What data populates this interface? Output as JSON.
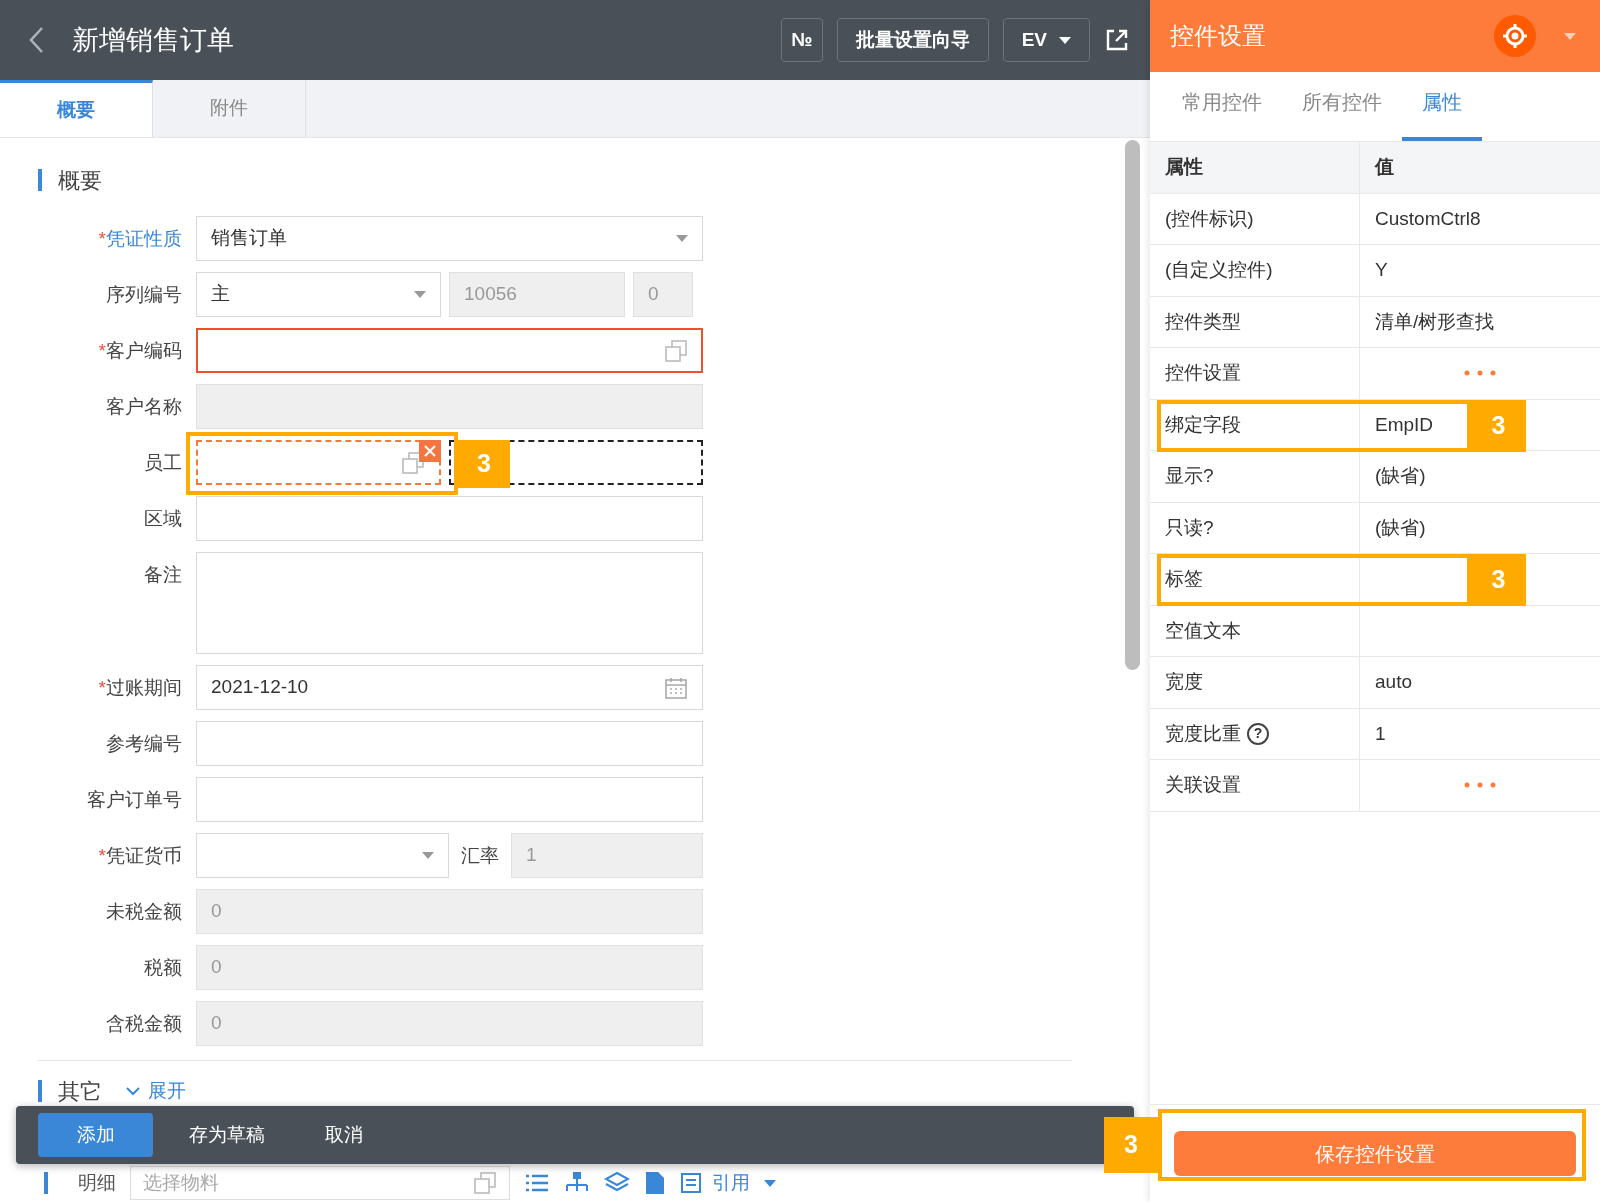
{
  "header": {
    "title": "新增销售订单",
    "buttons": [
      {
        "kind": "text",
        "label": "№"
      },
      {
        "kind": "text",
        "label": "批量设置向导"
      },
      {
        "kind": "dropdown",
        "label": "EV"
      }
    ]
  },
  "tabs": [
    {
      "label": "概要",
      "selected": true
    },
    {
      "label": "附件",
      "selected": false
    }
  ],
  "section": {
    "title": "概要"
  },
  "form": {
    "rows": [
      {
        "label": "凭证性质",
        "required_mark": "*",
        "link": true,
        "fields": [
          {
            "kind": "select",
            "value": "销售订单",
            "disabled": false,
            "invalid": false,
            "selected": false
          }
        ]
      },
      {
        "label": "序列编号",
        "link": false,
        "fields": [
          {
            "kind": "select",
            "value": "主",
            "disabled": false,
            "invalid": false,
            "selected": false
          },
          {
            "kind": "text",
            "value": "10056",
            "disabled": true,
            "invalid": false,
            "selected": false
          },
          {
            "kind": "text",
            "value": "0",
            "disabled": true,
            "invalid": false,
            "selected": false
          }
        ]
      },
      {
        "label": "客户编码",
        "required_mark": "*",
        "link": false,
        "fields": [
          {
            "kind": "lookup",
            "disabled": false,
            "invalid": true,
            "selected": false
          }
        ]
      },
      {
        "label": "客户名称",
        "link": false,
        "fields": [
          {
            "kind": "text",
            "disabled": true,
            "invalid": false,
            "selected": false
          }
        ]
      },
      {
        "label": "员工",
        "link": false,
        "fields": [
          {
            "kind": "lookup",
            "disabled": false,
            "invalid": false,
            "selected": true,
            "callout": "3"
          },
          {
            "kind": "placeholder",
            "disabled": false,
            "invalid": false,
            "selected": false
          }
        ]
      },
      {
        "label": "区域",
        "link": false,
        "fields": [
          {
            "kind": "text",
            "disabled": false,
            "invalid": false,
            "selected": false
          }
        ]
      },
      {
        "label": "备注",
        "link": false,
        "fields": [
          {
            "kind": "textarea",
            "disabled": false,
            "invalid": false,
            "selected": false
          }
        ]
      },
      {
        "label": "过账期间",
        "required_mark": "*",
        "link": false,
        "fields": [
          {
            "kind": "date",
            "value": "2021-12-10",
            "disabled": false,
            "invalid": false,
            "selected": false
          }
        ]
      },
      {
        "label": "参考编号",
        "link": false,
        "fields": [
          {
            "kind": "text",
            "disabled": false,
            "invalid": false,
            "selected": false
          }
        ]
      },
      {
        "label": "客户订单号",
        "link": false,
        "fields": [
          {
            "kind": "text",
            "disabled": false,
            "invalid": false,
            "selected": false
          }
        ]
      },
      {
        "label": "凭证货币",
        "required_mark": "*",
        "link": false,
        "inline_label": "汇率",
        "fields": [
          {
            "kind": "select",
            "disabled": false,
            "invalid": false,
            "selected": false
          },
          {
            "kind": "text",
            "value": "1",
            "disabled": true,
            "invalid": false,
            "selected": false
          }
        ]
      },
      {
        "label": "未税金额",
        "link": false,
        "fields": [
          {
            "kind": "text",
            "value": "0",
            "disabled": true,
            "invalid": false,
            "selected": false
          }
        ]
      },
      {
        "label": "税额",
        "link": false,
        "fields": [
          {
            "kind": "text",
            "value": "0",
            "disabled": true,
            "invalid": false,
            "selected": false
          }
        ]
      },
      {
        "label": "含税金额",
        "link": false,
        "fields": [
          {
            "kind": "text",
            "value": "0",
            "disabled": true,
            "invalid": false,
            "selected": false
          }
        ]
      }
    ]
  },
  "other_section": {
    "title": "其它",
    "toggle": "展开"
  },
  "action_bar": {
    "buttons": [
      {
        "label": "添加",
        "primary": true
      },
      {
        "label": "存为草稿",
        "primary": false
      },
      {
        "label": "取消",
        "primary": false
      }
    ]
  },
  "detail_bar": {
    "title": "明细",
    "search_placeholder": "选择物料",
    "reference": "引用"
  },
  "panel": {
    "title": "控件设置",
    "tabs": [
      {
        "label": "常用控件",
        "selected": false
      },
      {
        "label": "所有控件",
        "selected": false
      },
      {
        "label": "属性",
        "selected": true
      }
    ],
    "columns": [
      "属性",
      "值"
    ],
    "rows": [
      {
        "name": "(控件标识)",
        "kind": "text",
        "value": "CustomCtrl8"
      },
      {
        "name": "(自定义控件)",
        "kind": "text",
        "value": "Y"
      },
      {
        "name": "控件类型",
        "kind": "text",
        "value": "清单/树形查找"
      },
      {
        "name": "控件设置",
        "kind": "more"
      },
      {
        "name": "绑定字段",
        "kind": "text",
        "value": "EmpID",
        "callout": "3"
      },
      {
        "name": "显示?",
        "kind": "text",
        "value": "(缺省)"
      },
      {
        "name": "只读?",
        "kind": "text",
        "value": "(缺省)"
      },
      {
        "name": "标签",
        "kind": "text",
        "callout": "3"
      },
      {
        "name": "空值文本",
        "kind": "text"
      },
      {
        "name": "宽度",
        "kind": "text",
        "value": "auto"
      },
      {
        "name": "宽度比重",
        "help": "?",
        "kind": "text",
        "value": "1"
      },
      {
        "name": "关联设置",
        "kind": "more"
      }
    ],
    "save_button": {
      "label": "保存控件设置",
      "callout": "3"
    }
  }
}
